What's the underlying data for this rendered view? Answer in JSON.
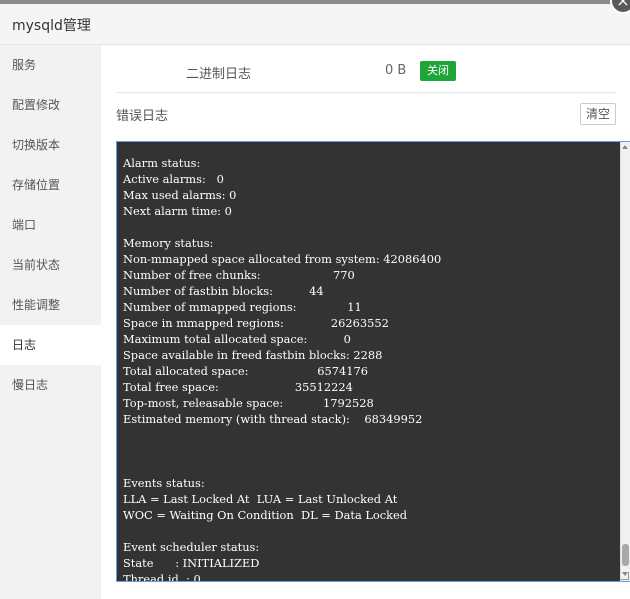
{
  "header": {
    "title": "mysqld管理",
    "close_icon": "×"
  },
  "sidebar": {
    "items": [
      {
        "label": "服务"
      },
      {
        "label": "配置修改"
      },
      {
        "label": "切换版本"
      },
      {
        "label": "存储位置"
      },
      {
        "label": "端口"
      },
      {
        "label": "当前状态"
      },
      {
        "label": "性能调整"
      },
      {
        "label": "日志",
        "active": true
      },
      {
        "label": "慢日志"
      }
    ]
  },
  "binlog": {
    "label": "二进制日志",
    "size": "0 B",
    "toggle_label": "关闭"
  },
  "errlog": {
    "label": "错误日志",
    "clear_label": "清空",
    "content": "Alarm status:\nActive alarms:   0\nMax used alarms: 0\nNext alarm time: 0\n\nMemory status:\nNon-mmapped space allocated from system: 42086400\nNumber of free chunks:                    770\nNumber of fastbin blocks:          44\nNumber of mmapped regions:              11\nSpace in mmapped regions:             26263552\nMaximum total allocated space:          0\nSpace available in freed fastbin blocks: 2288\nTotal allocated space:                   6574176\nTotal free space:                     35512224\nTop-most, releasable space:           1792528\nEstimated memory (with thread stack):    68349952\n\n\n\nEvents status:\nLLA = Last Locked At  LUA = Last Unlocked At\nWOC = Waiting On Condition  DL = Data Locked\n\nEvent scheduler status:\nState      : INITIALIZED\nThread id  : 0"
  }
}
